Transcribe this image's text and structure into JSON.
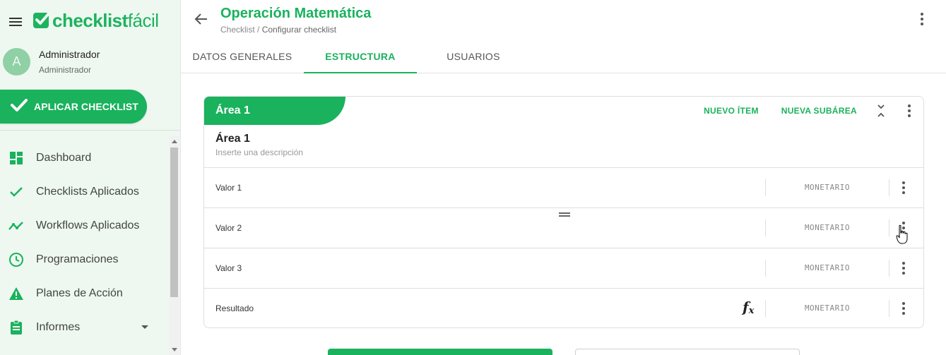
{
  "brand": {
    "name_bold": "checklist",
    "name_light": "fácil",
    "color": "#1db35e"
  },
  "user": {
    "initial": "A",
    "name": "Administrador",
    "role": "Administrador"
  },
  "sidebar": {
    "apply_label": "APLICAR CHECKLIST",
    "items": [
      {
        "label": "Dashboard",
        "icon": "dashboard-icon"
      },
      {
        "label": "Checklists Aplicados",
        "icon": "check-icon"
      },
      {
        "label": "Workflows Aplicados",
        "icon": "trending-icon"
      },
      {
        "label": "Programaciones",
        "icon": "clock-icon"
      },
      {
        "label": "Planes de Acción",
        "icon": "warning-icon"
      },
      {
        "label": "Informes",
        "icon": "clipboard-icon"
      }
    ]
  },
  "header": {
    "title": "Operación Matemática",
    "breadcrumb_parent": "Checklist",
    "breadcrumb_sep": "/",
    "breadcrumb_current": "Configurar checklist"
  },
  "tabs": [
    {
      "label": "DATOS GENERALES",
      "active": false
    },
    {
      "label": "ESTRUCTURA",
      "active": true
    },
    {
      "label": "USUARIOS",
      "active": false
    }
  ],
  "area": {
    "tab_label": "Área 1",
    "name": "Área 1",
    "description_placeholder": "Inserte una descripción",
    "new_item_label": "NUEVO ÍTEM",
    "new_subarea_label": "NUEVA SUBÁREA"
  },
  "rows": [
    {
      "label": "Valor 1",
      "type": "MONETARIO",
      "formula": false
    },
    {
      "label": "Valor 2",
      "type": "MONETARIO",
      "formula": false
    },
    {
      "label": "Valor 3",
      "type": "MONETARIO",
      "formula": false
    },
    {
      "label": "Resultado",
      "type": "MONETARIO",
      "formula": true
    }
  ],
  "formula_symbol": "f",
  "formula_sub": "x",
  "colors": {
    "accent": "#1ab25d",
    "sidebar_bg": "#eef8f0"
  }
}
